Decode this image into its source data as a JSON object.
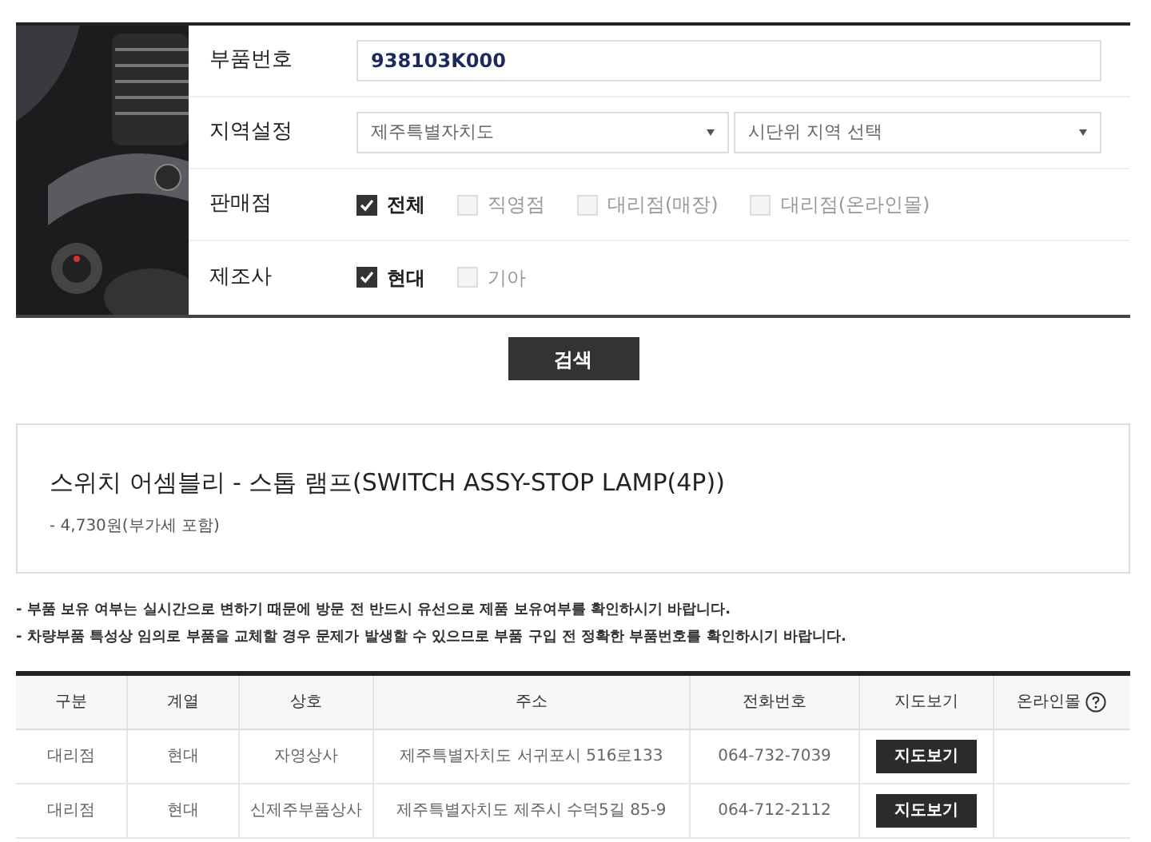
{
  "form": {
    "part_number": {
      "label": "부품번호",
      "value": "938103K000"
    },
    "region": {
      "label": "지역설정",
      "province": "제주특별자치도",
      "city_placeholder": "시단위 지역 선택"
    },
    "dealer": {
      "label": "판매점",
      "options": [
        {
          "label": "전체",
          "checked": true
        },
        {
          "label": "직영점",
          "checked": false
        },
        {
          "label": "대리점(매장)",
          "checked": false
        },
        {
          "label": "대리점(온라인몰)",
          "checked": false
        }
      ]
    },
    "maker": {
      "label": "제조사",
      "options": [
        {
          "label": "현대",
          "checked": true
        },
        {
          "label": "기아",
          "checked": false
        }
      ]
    }
  },
  "search_button": "검색",
  "product": {
    "name": "스위치 어셈블리 - 스톱 램프(SWITCH ASSY-STOP LAMP(4P))",
    "price": "- 4,730원(부가세 포함)"
  },
  "notes": [
    "- 부품 보유 여부는 실시간으로 변하기 때문에 방문 전 반드시 유선으로 제품 보유여부를 확인하시기 바랍니다.",
    "- 차량부품 특성상 임의로 부품을 교체할 경우 문제가 발생할 수 있으므로 부품 구입 전 정확한 부품번호를 확인하시기 바랍니다."
  ],
  "table": {
    "columns": [
      "구분",
      "계열",
      "상호",
      "주소",
      "전화번호",
      "지도보기",
      "온라인몰"
    ],
    "rows": [
      {
        "type": "대리점",
        "brand": "현대",
        "name": "자영상사",
        "address": "제주특별자치도 서귀포시 516로133",
        "phone": "064-732-7039",
        "map_button": "지도보기"
      },
      {
        "type": "대리점",
        "brand": "현대",
        "name": "신제주부품상사",
        "address": "제주특별자치도 제주시 수덕5길 85-9",
        "phone": "064-712-2112",
        "map_button": "지도보기"
      }
    ]
  }
}
